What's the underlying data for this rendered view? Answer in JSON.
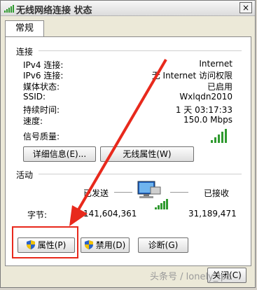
{
  "window": {
    "title": "无线网络连接 状态",
    "close_glyph": "×"
  },
  "tabs": [
    {
      "label": "常规"
    }
  ],
  "connection": {
    "title": "连接",
    "rows": [
      {
        "label": "IPv4 连接:",
        "value": "Internet"
      },
      {
        "label": "IPv6 连接:",
        "value": "无 Internet 访问权限"
      },
      {
        "label": "媒体状态:",
        "value": "已启用"
      },
      {
        "label": "SSID:",
        "value": "Wxlqdn2010"
      },
      {
        "label": "持续时间:",
        "value": "1 天 03:17:33"
      },
      {
        "label": "速度:",
        "value": "150.0 Mbps"
      }
    ],
    "signal_label": "信号质量:",
    "signal_bars": 5,
    "details_button": "详细信息(E)...",
    "wireless_props_button": "无线属性(W)"
  },
  "activity": {
    "title": "活动",
    "sent_label": "已发送",
    "received_label": "已接收",
    "bytes_label": "字节:",
    "bytes_sent": "141,604,361",
    "bytes_received": "31,189,471"
  },
  "buttons": {
    "properties": "属性(P)",
    "disable": "禁用(D)",
    "diagnose": "诊断(G)",
    "close": "关闭(C)"
  },
  "watermark": "头条号 / lonely_ipc",
  "colors": {
    "signal": "#2f9a2f",
    "highlight": "#e8291c",
    "shield_blue": "#2a62c9",
    "shield_yellow": "#f2c200"
  }
}
